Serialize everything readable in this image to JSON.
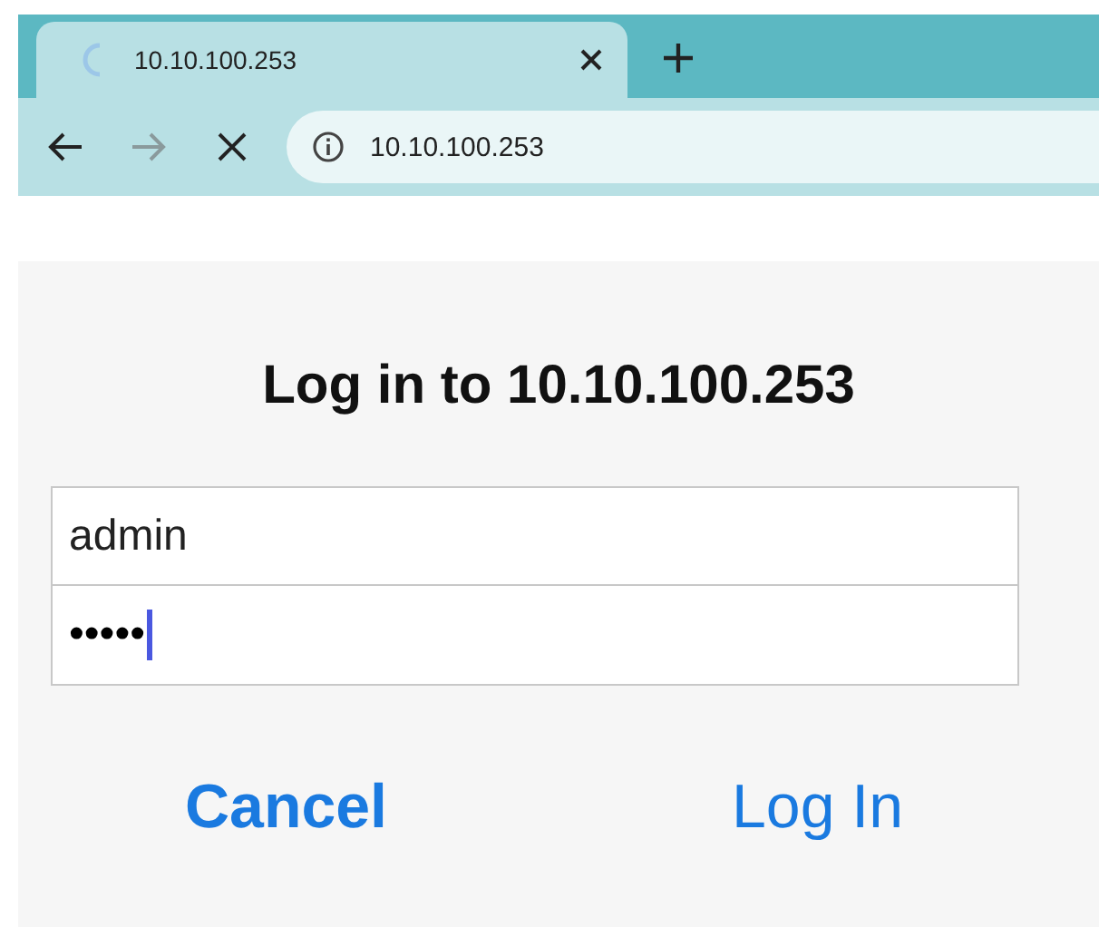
{
  "browser": {
    "tabs": [
      {
        "title": "10.10.100.253",
        "selected": true,
        "loading": true
      }
    ],
    "nav_buttons": [
      {
        "kind": "back",
        "disabled": false
      },
      {
        "kind": "forward",
        "disabled": true
      },
      {
        "kind": "stop",
        "disabled": false
      }
    ],
    "address": "10.10.100.253"
  },
  "dialog": {
    "title": "Log in to 10.10.100.253",
    "fields": [
      {
        "kind": "username",
        "value": "admin",
        "focused": false
      },
      {
        "kind": "password",
        "value": "•••••",
        "focused": true
      }
    ],
    "buttons": [
      {
        "label": "Cancel",
        "primary": true
      },
      {
        "label": "Log In",
        "primary": false
      }
    ]
  }
}
